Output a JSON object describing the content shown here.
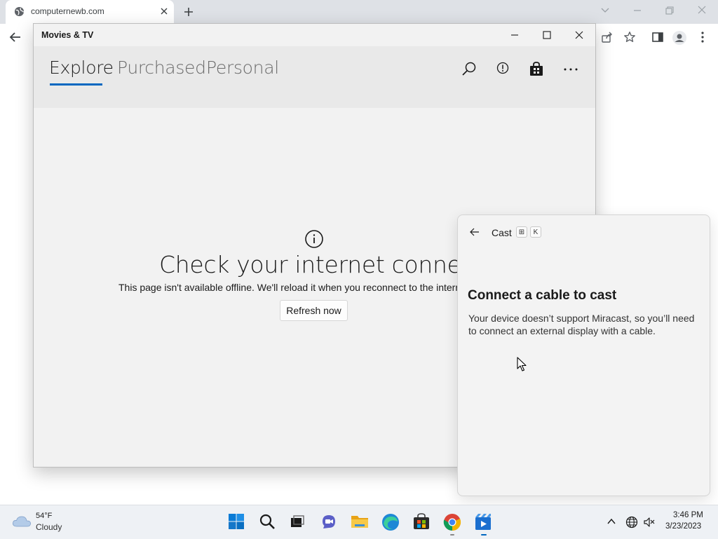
{
  "browser": {
    "tab_title": "computernewb.com",
    "icons": {
      "favicon": "globe-icon",
      "tab_close": "close-icon",
      "new_tab": "plus-icon",
      "tab_search": "chevron-down-icon",
      "minimize": "minimize-icon",
      "restore": "restore-icon",
      "close": "close-icon",
      "back": "back-arrow-icon",
      "share": "share-icon",
      "bookmark": "star-icon",
      "side_panel": "side-panel-icon",
      "profile": "profile-icon",
      "menu": "kebab-menu-icon"
    }
  },
  "app": {
    "title": "Movies & TV",
    "tabs": [
      {
        "label": "Explore",
        "active": true
      },
      {
        "label": "Purchased",
        "active": false
      },
      {
        "label": "Personal",
        "active": false
      }
    ],
    "header_icons": [
      "search-icon",
      "info-icon",
      "store-bag-icon",
      "more-icon"
    ],
    "accent_color": "#0067c0",
    "offline": {
      "icon": "info-icon",
      "title": "Check your internet connection",
      "message": "This page isn't available offline. We'll reload it when you reconnect to the internet.",
      "button_label": "Refresh now"
    }
  },
  "cast": {
    "title": "Cast",
    "shortcut_keys": [
      "⊞",
      "K"
    ],
    "heading": "Connect a cable to cast",
    "description": "Your device doesn’t support Miracast, so you’ll need to connect an external display with a cable."
  },
  "taskbar": {
    "weather": {
      "temp": "54°F",
      "condition": "Cloudy",
      "icon": "cloud-icon"
    },
    "apps": [
      "start-icon",
      "search-icon",
      "task-view-icon",
      "chat-icon",
      "file-explorer-icon",
      "edge-icon",
      "store-icon",
      "chrome-icon",
      "movies-tv-icon"
    ],
    "tray": [
      "chevron-up-icon",
      "network-globe-icon",
      "volume-muted-icon"
    ],
    "time": "3:46 PM",
    "date": "3/23/2023"
  }
}
